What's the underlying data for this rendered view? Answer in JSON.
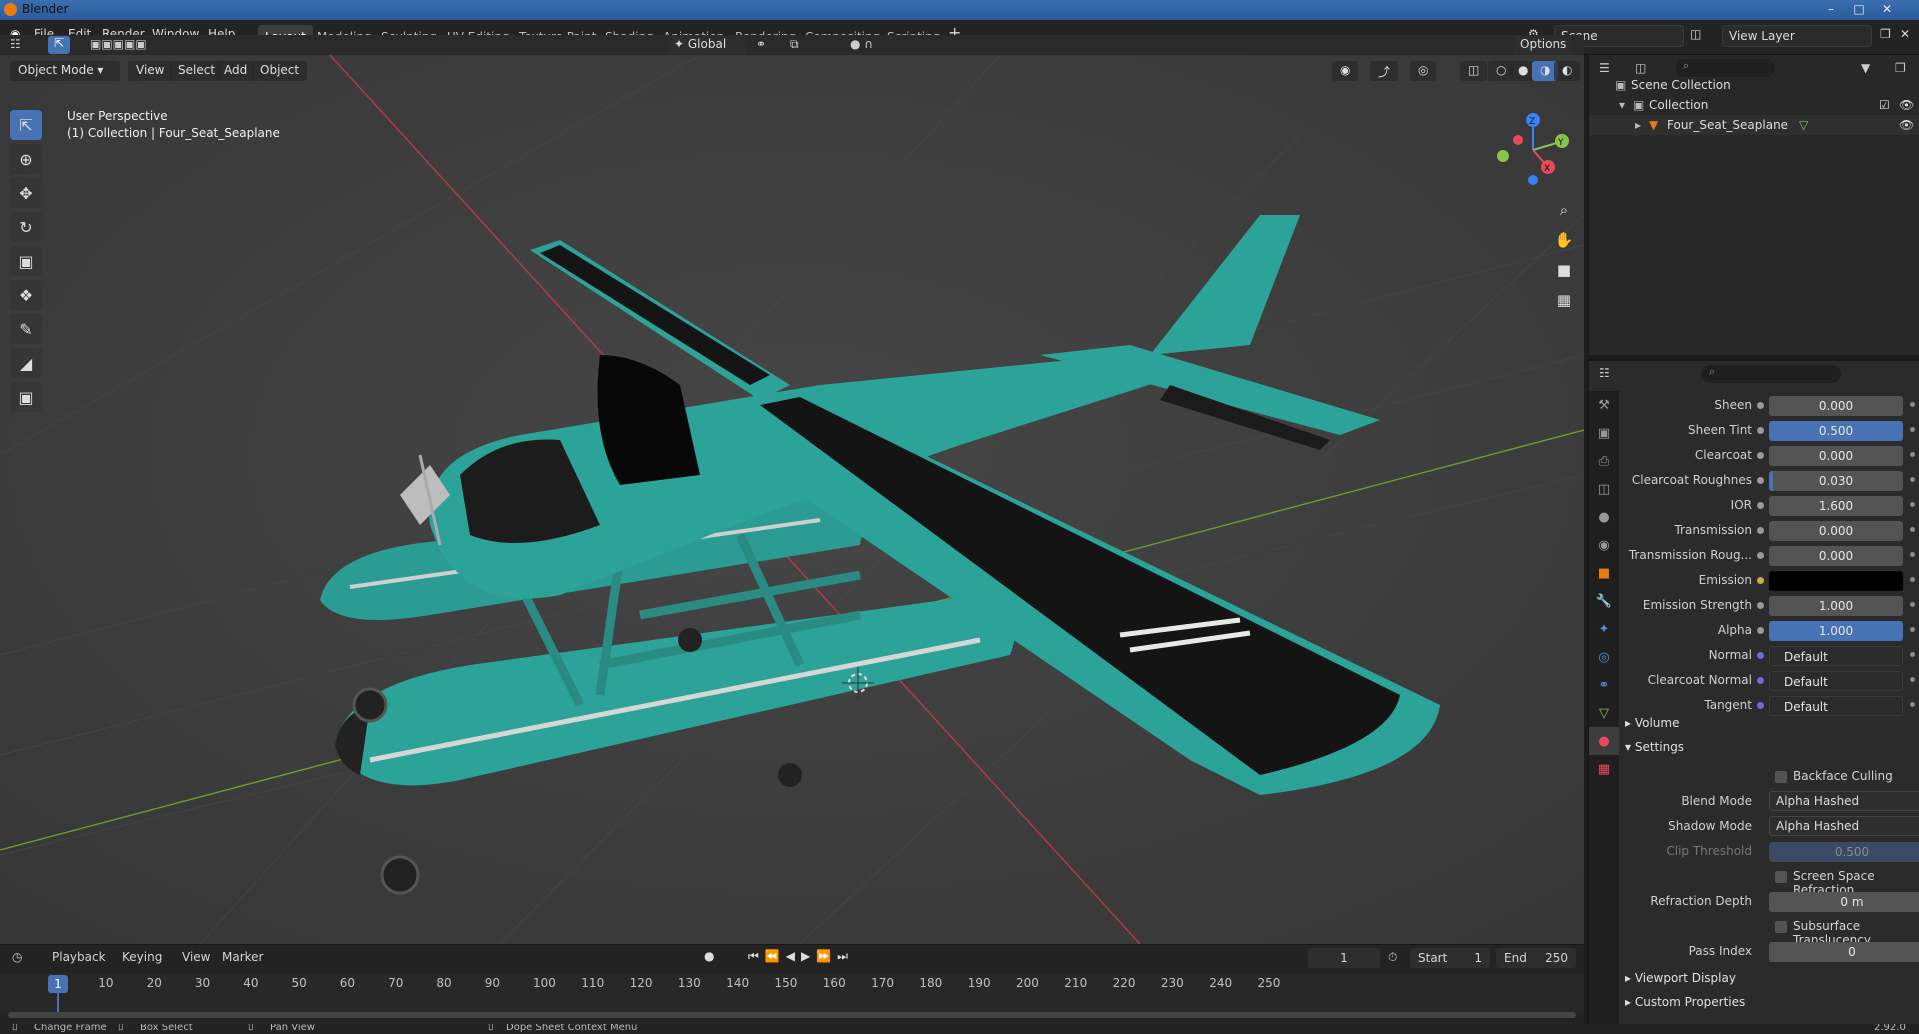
{
  "window": {
    "title": "Blender"
  },
  "menu": [
    "File",
    "Edit",
    "Render",
    "Window",
    "Help"
  ],
  "workspaces": [
    "Layout",
    "Modeling",
    "Sculpting",
    "UV Editing",
    "Texture Paint",
    "Shading",
    "Animation",
    "Rendering",
    "Compositing",
    "Scripting"
  ],
  "active_workspace": "Layout",
  "scene": {
    "name": "Scene",
    "view_layer": "View Layer"
  },
  "viewport": {
    "mode": "Object Mode",
    "menus": [
      "View",
      "Select",
      "Add",
      "Object"
    ],
    "orientation": "Global",
    "options_label": "Options",
    "perspective_label": "User Perspective",
    "collection_label": "(1) Collection | Four_Seat_Seaplane",
    "gizmo": {
      "x": "X",
      "y": "Y",
      "z": "Z"
    }
  },
  "colors": {
    "accent": "#4772b3",
    "object_orange": "#e87d0d",
    "axis_x": "#e84a5a",
    "axis_y": "#8bc34a",
    "axis_z": "#3b82f6",
    "plane_teal": "#2aa39a"
  },
  "outliner": {
    "items": [
      {
        "label": "Scene Collection"
      },
      {
        "label": "Collection"
      },
      {
        "label": "Four_Seat_Seaplane"
      }
    ]
  },
  "properties": {
    "rows": [
      {
        "label": "Sheen",
        "value": "0.000",
        "fill": 0.0,
        "style": "num"
      },
      {
        "label": "Sheen Tint",
        "value": "0.500",
        "fill": 1.0,
        "style": "num"
      },
      {
        "label": "Clearcoat",
        "value": "0.000",
        "fill": 0.0,
        "style": "num"
      },
      {
        "label": "Clearcoat Roughnes",
        "value": "0.030",
        "fill": 0.03,
        "style": "num"
      },
      {
        "label": "IOR",
        "value": "1.600",
        "fill": 0.0,
        "style": "num"
      },
      {
        "label": "Transmission",
        "value": "0.000",
        "fill": 0.0,
        "style": "num"
      },
      {
        "label": "Transmission Roug...",
        "value": "0.000",
        "fill": 0.0,
        "style": "num"
      },
      {
        "label": "Emission",
        "value": "",
        "fill": 0.0,
        "style": "color"
      },
      {
        "label": "Emission Strength",
        "value": "1.000",
        "fill": 0.0,
        "style": "num"
      },
      {
        "label": "Alpha",
        "value": "1.000",
        "fill": 1.0,
        "style": "num"
      },
      {
        "label": "Normal",
        "value": "Default",
        "fill": 0.0,
        "style": "link"
      },
      {
        "label": "Clearcoat Normal",
        "value": "Default",
        "fill": 0.0,
        "style": "link"
      },
      {
        "label": "Tangent",
        "value": "Default",
        "fill": 0.0,
        "style": "link"
      }
    ],
    "sections": {
      "volume": "Volume",
      "settings": "Settings",
      "viewport_display": "Viewport Display",
      "custom_properties": "Custom Properties"
    },
    "settings": {
      "backface_culling": "Backface Culling",
      "blend_mode_label": "Blend Mode",
      "blend_mode": "Alpha Hashed",
      "shadow_mode_label": "Shadow Mode",
      "shadow_mode": "Alpha Hashed",
      "clip_threshold_label": "Clip Threshold",
      "clip_threshold": "0.500",
      "ssr": "Screen Space Refraction",
      "refraction_depth_label": "Refraction Depth",
      "refraction_depth": "0 m",
      "subsurface": "Subsurface Translucency",
      "pass_index_label": "Pass Index",
      "pass_index": "0"
    }
  },
  "timeline": {
    "menus": [
      "Playback",
      "Keying",
      "View",
      "Marker"
    ],
    "current_frame": "1",
    "start_label": "Start",
    "start": "1",
    "end_label": "End",
    "end": "250",
    "ticks": [
      "10",
      "20",
      "30",
      "40",
      "50",
      "60",
      "70",
      "80",
      "90",
      "100",
      "110",
      "120",
      "130",
      "140",
      "150",
      "160",
      "170",
      "180",
      "190",
      "200",
      "210",
      "220",
      "230",
      "240",
      "250"
    ]
  },
  "status": {
    "change_frame": "Change Frame",
    "box_select": "Box Select",
    "pan_view": "Pan View",
    "context_menu": "Dope Sheet Context Menu",
    "version": "2.92.0"
  }
}
